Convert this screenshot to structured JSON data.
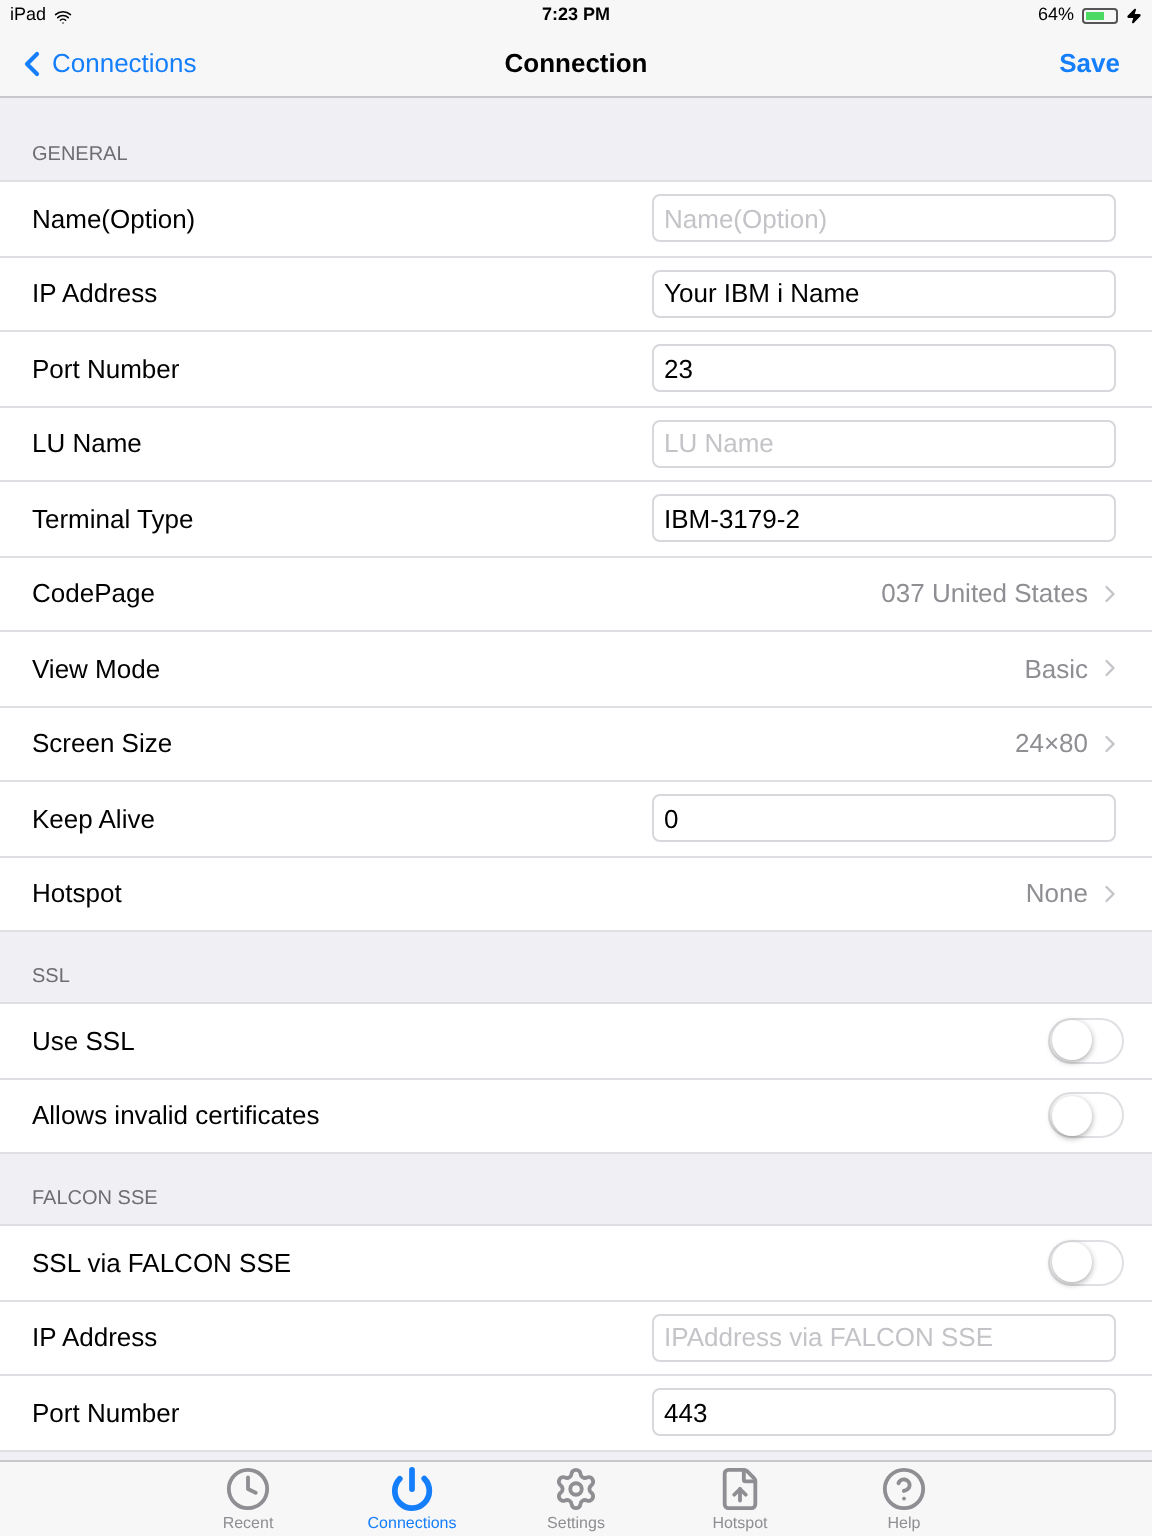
{
  "status_bar": {
    "carrier": "iPad",
    "time": "7:23 PM",
    "battery": "64%"
  },
  "nav": {
    "back": "Connections",
    "title": "Connection",
    "action": "Save"
  },
  "sections": [
    {
      "title": "GENERAL",
      "rows": [
        {
          "kind": "field",
          "label": "Name(Option)",
          "placeholder": "Name(Option)"
        },
        {
          "kind": "field",
          "label": "IP Address",
          "value": "Your IBM i Name"
        },
        {
          "kind": "field",
          "label": "Port Number",
          "value": "23"
        },
        {
          "kind": "field",
          "label": "LU Name",
          "placeholder": "LU Name"
        },
        {
          "kind": "field",
          "label": "Terminal Type",
          "value": "IBM-3179-2"
        },
        {
          "kind": "select",
          "label": "CodePage",
          "value": "037 United States"
        },
        {
          "kind": "select",
          "label": "View Mode",
          "value": "Basic"
        },
        {
          "kind": "select",
          "label": "Screen Size",
          "value": "24×80"
        },
        {
          "kind": "field",
          "label": "Keep Alive",
          "value": "0"
        },
        {
          "kind": "select",
          "label": "Hotspot",
          "value": "None"
        }
      ]
    },
    {
      "title": "SSL",
      "rows": [
        {
          "kind": "toggle",
          "label": "Use SSL",
          "on": false
        },
        {
          "kind": "toggle",
          "label": "Allows invalid certificates",
          "on": false
        }
      ]
    },
    {
      "title": "FALCON SSE",
      "rows": [
        {
          "kind": "toggle",
          "label": "SSL via FALCON SSE",
          "on": false
        },
        {
          "kind": "field",
          "label": "IP Address",
          "placeholder": "IPAddress via FALCON SSE"
        },
        {
          "kind": "field",
          "label": "Port Number",
          "value": "443"
        }
      ]
    }
  ],
  "tabs": [
    {
      "kind": "clock",
      "label": "Recent",
      "selected": false
    },
    {
      "kind": "power",
      "label": "Connections",
      "selected": true
    },
    {
      "kind": "gear",
      "label": "Settings",
      "selected": false
    },
    {
      "kind": "upload",
      "label": "Hotspot",
      "selected": false
    },
    {
      "kind": "help",
      "label": "Help",
      "selected": false
    }
  ]
}
